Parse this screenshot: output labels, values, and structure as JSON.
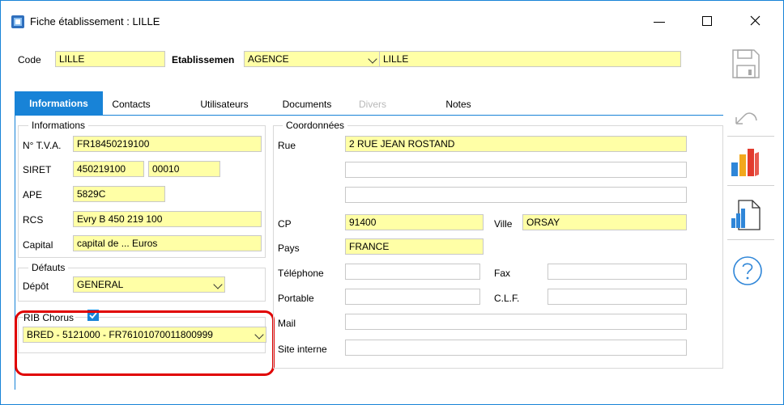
{
  "window": {
    "title": "Fiche établissement : LILLE",
    "app_icon": "app-icon"
  },
  "header": {
    "code_label": "Code",
    "code_value": "LILLE",
    "etab_label": "Etablissemen",
    "etab_select": "AGENCE",
    "etab_value": "LILLE"
  },
  "tabs": [
    {
      "label": "Informations",
      "state": "active"
    },
    {
      "label": "Contacts",
      "state": "normal"
    },
    {
      "label": "Utilisateurs",
      "state": "normal"
    },
    {
      "label": "Documents",
      "state": "normal"
    },
    {
      "label": "Divers",
      "state": "disabled"
    },
    {
      "label": "Notes",
      "state": "normal"
    }
  ],
  "informations": {
    "title": "Informations",
    "tva_label": "N° T.V.A.",
    "tva_value": "FR18450219100",
    "siret_label": "SIRET",
    "siret_value": "450219100",
    "siret_suffix": "00010",
    "ape_label": "APE",
    "ape_value": "5829C",
    "rcs_label": "RCS",
    "rcs_value": "Evry B 450 219 100",
    "capital_label": "Capital",
    "capital_value": "capital de ... Euros"
  },
  "defauts": {
    "title": "Défauts",
    "depot_label": "Dépôt",
    "depot_value": "GENERAL"
  },
  "rib": {
    "label": "RIB Chorus",
    "checked": true,
    "value": "BRED - 5121000 - FR76101070011800999"
  },
  "coordonnees": {
    "title": "Coordonnées",
    "rue_label": "Rue",
    "rue_value": "2 RUE JEAN ROSTAND",
    "cp_label": "CP",
    "cp_value": "91400",
    "ville_label": "Ville",
    "ville_value": "ORSAY",
    "pays_label": "Pays",
    "pays_value": "FRANCE",
    "tel_label": "Téléphone",
    "fax_label": "Fax",
    "portable_label": "Portable",
    "clf_label": "C.L.F.",
    "mail_label": "Mail",
    "site_label": "Site interne"
  },
  "toolbar": [
    "save-icon",
    "undo-icon",
    "chart-icon",
    "report-icon",
    "help-icon"
  ],
  "colors": {
    "accent": "#1883d7",
    "field_yellow": "#ffffa6",
    "highlight_red": "#e00000"
  }
}
